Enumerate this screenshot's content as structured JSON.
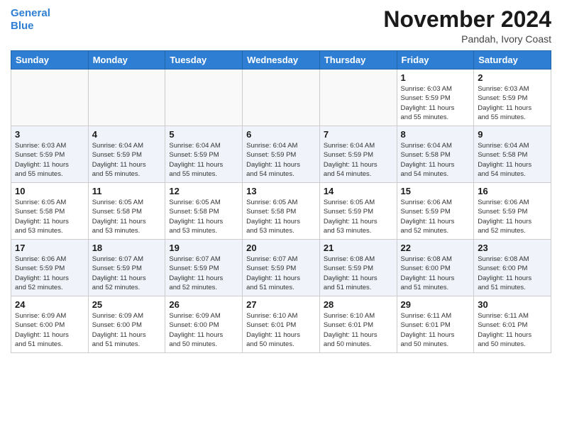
{
  "header": {
    "logo_line1": "General",
    "logo_line2": "Blue",
    "month_title": "November 2024",
    "location": "Pandah, Ivory Coast"
  },
  "weekdays": [
    "Sunday",
    "Monday",
    "Tuesday",
    "Wednesday",
    "Thursday",
    "Friday",
    "Saturday"
  ],
  "weeks": [
    [
      {
        "day": "",
        "info": ""
      },
      {
        "day": "",
        "info": ""
      },
      {
        "day": "",
        "info": ""
      },
      {
        "day": "",
        "info": ""
      },
      {
        "day": "",
        "info": ""
      },
      {
        "day": "1",
        "info": "Sunrise: 6:03 AM\nSunset: 5:59 PM\nDaylight: 11 hours\nand 55 minutes."
      },
      {
        "day": "2",
        "info": "Sunrise: 6:03 AM\nSunset: 5:59 PM\nDaylight: 11 hours\nand 55 minutes."
      }
    ],
    [
      {
        "day": "3",
        "info": "Sunrise: 6:03 AM\nSunset: 5:59 PM\nDaylight: 11 hours\nand 55 minutes."
      },
      {
        "day": "4",
        "info": "Sunrise: 6:04 AM\nSunset: 5:59 PM\nDaylight: 11 hours\nand 55 minutes."
      },
      {
        "day": "5",
        "info": "Sunrise: 6:04 AM\nSunset: 5:59 PM\nDaylight: 11 hours\nand 55 minutes."
      },
      {
        "day": "6",
        "info": "Sunrise: 6:04 AM\nSunset: 5:59 PM\nDaylight: 11 hours\nand 54 minutes."
      },
      {
        "day": "7",
        "info": "Sunrise: 6:04 AM\nSunset: 5:59 PM\nDaylight: 11 hours\nand 54 minutes."
      },
      {
        "day": "8",
        "info": "Sunrise: 6:04 AM\nSunset: 5:58 PM\nDaylight: 11 hours\nand 54 minutes."
      },
      {
        "day": "9",
        "info": "Sunrise: 6:04 AM\nSunset: 5:58 PM\nDaylight: 11 hours\nand 54 minutes."
      }
    ],
    [
      {
        "day": "10",
        "info": "Sunrise: 6:05 AM\nSunset: 5:58 PM\nDaylight: 11 hours\nand 53 minutes."
      },
      {
        "day": "11",
        "info": "Sunrise: 6:05 AM\nSunset: 5:58 PM\nDaylight: 11 hours\nand 53 minutes."
      },
      {
        "day": "12",
        "info": "Sunrise: 6:05 AM\nSunset: 5:58 PM\nDaylight: 11 hours\nand 53 minutes."
      },
      {
        "day": "13",
        "info": "Sunrise: 6:05 AM\nSunset: 5:58 PM\nDaylight: 11 hours\nand 53 minutes."
      },
      {
        "day": "14",
        "info": "Sunrise: 6:05 AM\nSunset: 5:59 PM\nDaylight: 11 hours\nand 53 minutes."
      },
      {
        "day": "15",
        "info": "Sunrise: 6:06 AM\nSunset: 5:59 PM\nDaylight: 11 hours\nand 52 minutes."
      },
      {
        "day": "16",
        "info": "Sunrise: 6:06 AM\nSunset: 5:59 PM\nDaylight: 11 hours\nand 52 minutes."
      }
    ],
    [
      {
        "day": "17",
        "info": "Sunrise: 6:06 AM\nSunset: 5:59 PM\nDaylight: 11 hours\nand 52 minutes."
      },
      {
        "day": "18",
        "info": "Sunrise: 6:07 AM\nSunset: 5:59 PM\nDaylight: 11 hours\nand 52 minutes."
      },
      {
        "day": "19",
        "info": "Sunrise: 6:07 AM\nSunset: 5:59 PM\nDaylight: 11 hours\nand 52 minutes."
      },
      {
        "day": "20",
        "info": "Sunrise: 6:07 AM\nSunset: 5:59 PM\nDaylight: 11 hours\nand 51 minutes."
      },
      {
        "day": "21",
        "info": "Sunrise: 6:08 AM\nSunset: 5:59 PM\nDaylight: 11 hours\nand 51 minutes."
      },
      {
        "day": "22",
        "info": "Sunrise: 6:08 AM\nSunset: 6:00 PM\nDaylight: 11 hours\nand 51 minutes."
      },
      {
        "day": "23",
        "info": "Sunrise: 6:08 AM\nSunset: 6:00 PM\nDaylight: 11 hours\nand 51 minutes."
      }
    ],
    [
      {
        "day": "24",
        "info": "Sunrise: 6:09 AM\nSunset: 6:00 PM\nDaylight: 11 hours\nand 51 minutes."
      },
      {
        "day": "25",
        "info": "Sunrise: 6:09 AM\nSunset: 6:00 PM\nDaylight: 11 hours\nand 51 minutes."
      },
      {
        "day": "26",
        "info": "Sunrise: 6:09 AM\nSunset: 6:00 PM\nDaylight: 11 hours\nand 50 minutes."
      },
      {
        "day": "27",
        "info": "Sunrise: 6:10 AM\nSunset: 6:01 PM\nDaylight: 11 hours\nand 50 minutes."
      },
      {
        "day": "28",
        "info": "Sunrise: 6:10 AM\nSunset: 6:01 PM\nDaylight: 11 hours\nand 50 minutes."
      },
      {
        "day": "29",
        "info": "Sunrise: 6:11 AM\nSunset: 6:01 PM\nDaylight: 11 hours\nand 50 minutes."
      },
      {
        "day": "30",
        "info": "Sunrise: 6:11 AM\nSunset: 6:01 PM\nDaylight: 11 hours\nand 50 minutes."
      }
    ]
  ]
}
